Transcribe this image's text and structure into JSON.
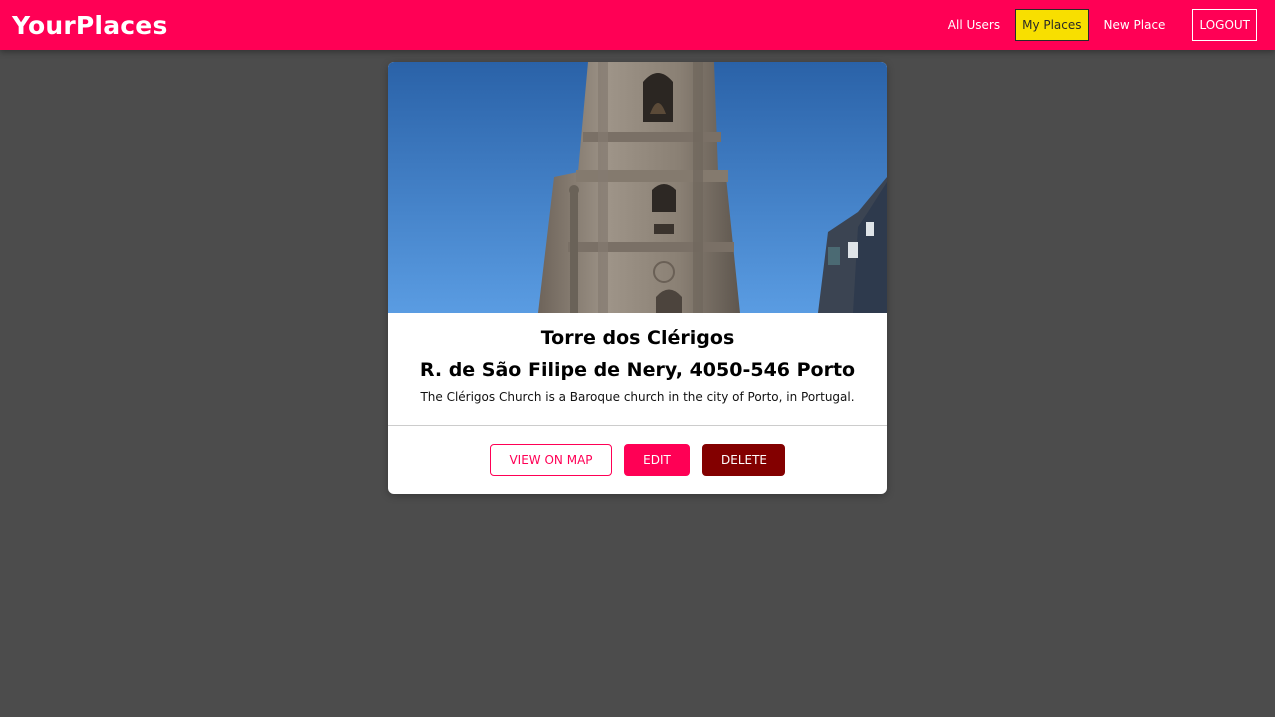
{
  "header": {
    "brand": "YourPlaces",
    "nav": {
      "all_users": "All Users",
      "my_places": "My Places",
      "new_place": "New Place",
      "logout": "LOGOUT"
    }
  },
  "place": {
    "title": "Torre dos Clérigos",
    "address": "R. de São Filipe de Nery, 4050-546 Porto",
    "description": "The Clérigos Church is a Baroque church in the city of Porto, in Portugal.",
    "actions": {
      "view_on_map": "VIEW ON MAP",
      "edit": "EDIT",
      "delete": "DELETE"
    }
  },
  "colors": {
    "brand": "#ff0055",
    "active_nav": "#f8df00",
    "danger": "#830000",
    "background": "#4c4c4c"
  }
}
